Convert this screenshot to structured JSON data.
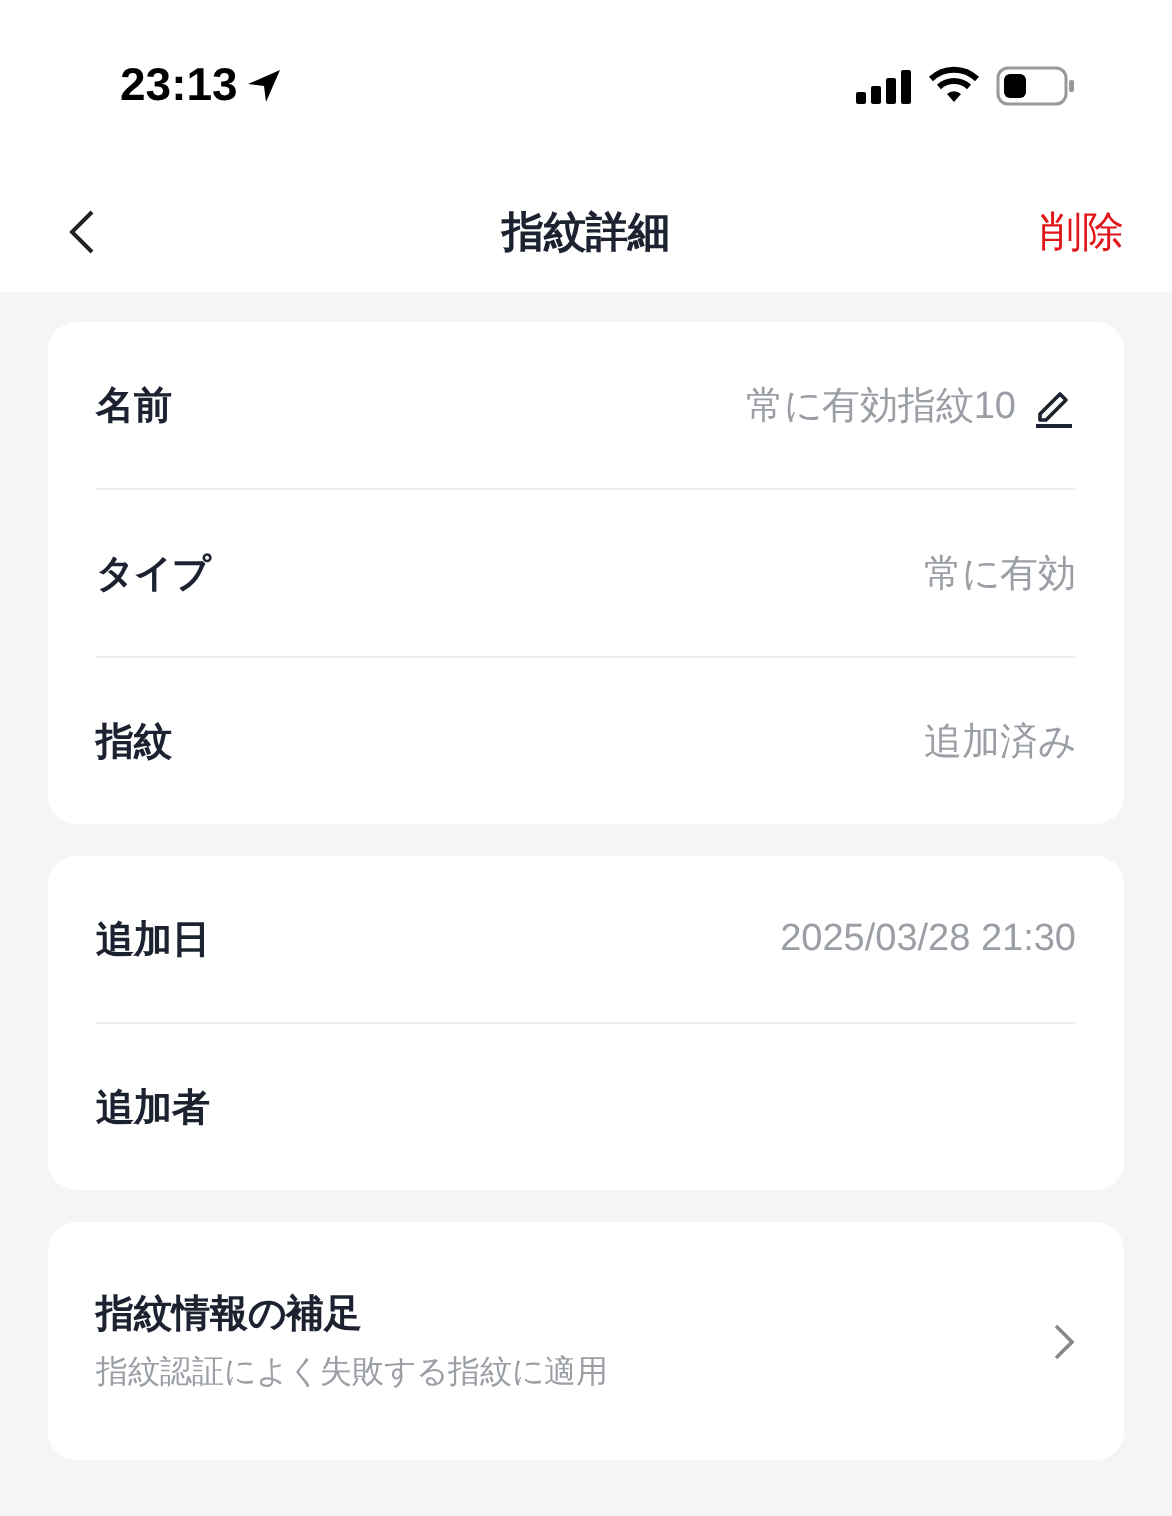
{
  "status_bar": {
    "time": "23:13"
  },
  "nav": {
    "title": "指紋詳細",
    "action": "削除"
  },
  "sections": [
    {
      "rows": [
        {
          "kind": "value",
          "label": "名前",
          "value": "常に有効指紋10",
          "editable": true
        },
        {
          "kind": "value",
          "label": "タイプ",
          "value": "常に有効",
          "editable": false
        },
        {
          "kind": "value",
          "label": "指紋",
          "value": "追加済み",
          "editable": false
        }
      ]
    },
    {
      "rows": [
        {
          "kind": "value",
          "label": "追加日",
          "value": "2025/03/28 21:30",
          "editable": false
        },
        {
          "kind": "value",
          "label": "追加者",
          "editable": false
        }
      ]
    },
    {
      "rows": [
        {
          "kind": "link",
          "label": "指紋情報の補足",
          "subtitle": "指紋認証によく失敗する指紋に適用"
        }
      ]
    }
  ]
}
